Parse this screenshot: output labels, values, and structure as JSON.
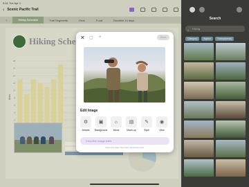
{
  "status": {
    "time": "9:41",
    "date": "Tue Apr 1"
  },
  "doc": {
    "title": "Scenic Pacific Trail",
    "tabs": [
      "Hiking Schedule",
      "Trail Segments",
      "Gear",
      "Food",
      "Duration 14 days"
    ],
    "heading": "Hiking Sche"
  },
  "chart_data": {
    "type": "bar",
    "title": "",
    "xlabel": "",
    "ylabel": "Miles",
    "ylim": [
      0,
      18
    ],
    "yticks": [
      "0",
      "2",
      "4",
      "6",
      "8",
      "10",
      "12",
      "14",
      "16",
      "18"
    ],
    "categories": [
      "",
      "",
      "",
      "",
      "",
      "",
      "",
      "",
      ""
    ],
    "values": [
      13,
      9,
      13,
      12,
      11,
      13,
      17,
      0,
      0
    ],
    "bar_color": "#d8d29a"
  },
  "table": {
    "rows": 3
  },
  "panel": {
    "title": "Search",
    "search_value": "Hiking",
    "filters": [
      "Category",
      "Aspect",
      "Transparency"
    ]
  },
  "modal": {
    "save_label": "Save",
    "section_label": "Edit Image",
    "tools": [
      {
        "label": "Details",
        "icon": "details-icon"
      },
      {
        "label": "Background",
        "icon": "background-icon"
      },
      {
        "label": "Mood",
        "icon": "mood-icon"
      },
      {
        "label": "Mash-up",
        "icon": "mashup-icon"
      },
      {
        "label": "Style",
        "icon": "style-icon"
      },
      {
        "label": "View",
        "icon": "view-icon"
      }
    ],
    "prompt_placeholder": "Describe image edits",
    "footnote": "Powered by Apple. May create unexpected results."
  }
}
